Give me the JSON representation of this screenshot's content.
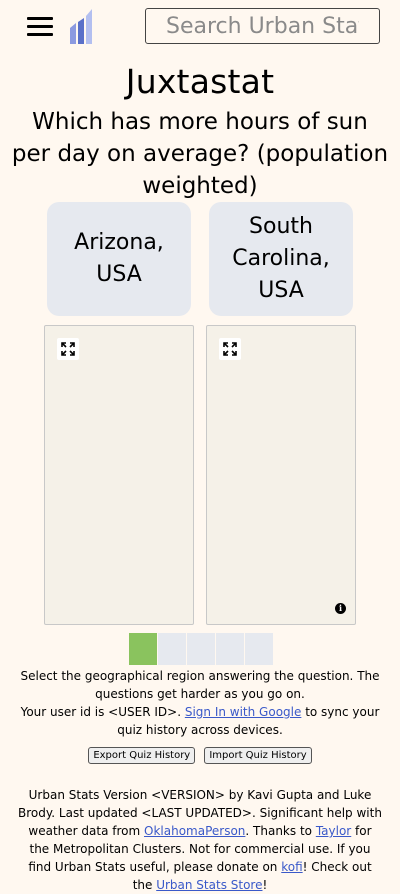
{
  "header": {
    "search_placeholder": "Search Urban Stats",
    "logo_colors": [
      "#5a70c8",
      "#8c9ae0",
      "#b3bff0"
    ]
  },
  "title": "Juxtastat",
  "question": "Which has more hours of sun per day on average? (population weighted)",
  "options": [
    {
      "label": "Arizona, USA"
    },
    {
      "label": "South Carolina, USA"
    }
  ],
  "maps": [
    {
      "expand_icon": "expand-icon"
    },
    {
      "expand_icon": "expand-icon",
      "info_icon": "info-icon",
      "info_glyph": "i"
    }
  ],
  "progress": {
    "states": [
      "correct",
      "pending",
      "pending",
      "pending",
      "pending"
    ],
    "colors": {
      "correct": "#8ac35e",
      "pending": "#e6e9ef"
    }
  },
  "help": {
    "line1": "Select the geographical region answering the question. The questions get harder as you go on.",
    "user_id_prefix": "Your user id is <USER ID>. ",
    "sign_in_link": "Sign In with Google",
    "sync_suffix": " to sync your quiz history across devices."
  },
  "buttons": {
    "export": "Export Quiz History",
    "import": "Import Quiz History"
  },
  "footer": {
    "part1": "Urban Stats Version <VERSION> by Kavi Gupta and Luke Brody. Last updated <LAST UPDATED>. Significant help with weather data from ",
    "link1": "OklahomaPerson",
    "part2": ". Thanks to ",
    "link2": "Taylor",
    "part3": " for the Metropolitan Clusters. Not for commercial use. If you find Urban Stats useful, please donate on ",
    "link3": "kofi",
    "part4": "! Check out the ",
    "link4": "Urban Stats Store",
    "part5": "!"
  },
  "colors": {
    "background": "#fff8f0",
    "option_background": "#e6e9ef",
    "link": "#3a59c9",
    "map_background": "#f5f1e8"
  }
}
